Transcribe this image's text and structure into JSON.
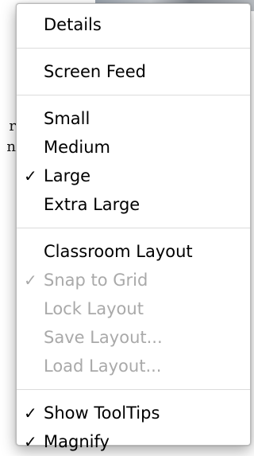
{
  "background": {
    "partial_text_1": "r",
    "partial_text_2": "n"
  },
  "menu": {
    "items": [
      {
        "label": "Details",
        "checked": false,
        "enabled": true
      },
      {
        "label": "Screen Feed",
        "checked": false,
        "enabled": true
      },
      {
        "label": "Small",
        "checked": false,
        "enabled": true
      },
      {
        "label": "Medium",
        "checked": false,
        "enabled": true
      },
      {
        "label": "Large",
        "checked": true,
        "enabled": true
      },
      {
        "label": "Extra Large",
        "checked": false,
        "enabled": true
      },
      {
        "label": "Classroom Layout",
        "checked": false,
        "enabled": true
      },
      {
        "label": "Snap to Grid",
        "checked": true,
        "enabled": false
      },
      {
        "label": "Lock Layout",
        "checked": false,
        "enabled": false
      },
      {
        "label": "Save Layout...",
        "checked": false,
        "enabled": false
      },
      {
        "label": "Load Layout...",
        "checked": false,
        "enabled": false
      },
      {
        "label": "Show ToolTips",
        "checked": true,
        "enabled": true
      },
      {
        "label": "Magnify",
        "checked": true,
        "enabled": true
      }
    ],
    "check_glyph": "✓",
    "colors": {
      "enabled_text": "#000000",
      "disabled_text": "#a9a9a9",
      "separator": "#dcdcdc"
    }
  }
}
